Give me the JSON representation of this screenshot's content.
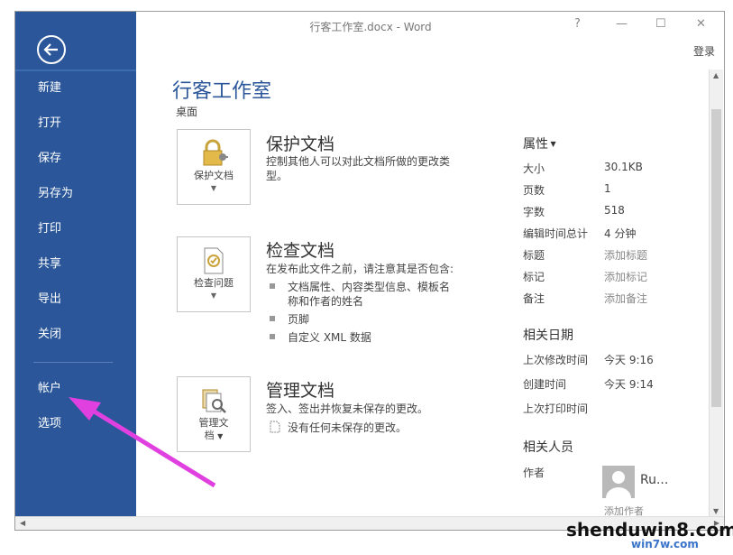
{
  "window": {
    "title": "行客工作室.docx - Word",
    "help": "?",
    "minimize": "—",
    "maximize": "☐",
    "close": "✕",
    "login": "登录"
  },
  "sidebar": {
    "items": [
      {
        "label": "新建"
      },
      {
        "label": "打开"
      },
      {
        "label": "保存"
      },
      {
        "label": "另存为"
      },
      {
        "label": "打印"
      },
      {
        "label": "共享"
      },
      {
        "label": "导出"
      },
      {
        "label": "关闭"
      },
      {
        "label": "帐户"
      },
      {
        "label": "选项"
      }
    ]
  },
  "main": {
    "title": "行客工作室",
    "path": "桌面",
    "protect": {
      "button": "保护文档",
      "title": "保护文档",
      "desc": "控制其他人可以对此文档所做的更改类型。"
    },
    "inspect": {
      "button": "检查问题",
      "title": "检查文档",
      "desc": "在发布此文件之前，请注意其是否包含:",
      "bullets": [
        "文档属性、内容类型信息、模板名称和作者的姓名",
        "页脚",
        "自定义 XML 数据"
      ]
    },
    "manage": {
      "button_line1": "管理文",
      "button_line2": "档",
      "title": "管理文档",
      "desc": "签入、签出并恢复未保存的更改。",
      "note": "没有任何未保存的更改。"
    }
  },
  "properties": {
    "heading": "属性",
    "rows": [
      {
        "label": "大小",
        "value": "30.1KB"
      },
      {
        "label": "页数",
        "value": "1"
      },
      {
        "label": "字数",
        "value": "518"
      },
      {
        "label": "编辑时间总计",
        "value": "4 分钟"
      },
      {
        "label": "标题",
        "value": "添加标题"
      },
      {
        "label": "标记",
        "value": "添加标记"
      },
      {
        "label": "备注",
        "value": "添加备注"
      }
    ],
    "dates_heading": "相关日期",
    "dates": [
      {
        "label": "上次修改时间",
        "value": "今天 9:16"
      },
      {
        "label": "创建时间",
        "value": "今天 9:14"
      },
      {
        "label": "上次打印时间",
        "value": ""
      }
    ],
    "people_heading": "相关人员",
    "author_label": "作者",
    "author_name": "Ru...",
    "add_author": "添加作者"
  },
  "watermark": {
    "text": "shenduwin8.com",
    "sub": "win7w.com"
  },
  "colors": {
    "sidebar": "#2b579a",
    "accent": "#2b579a",
    "arrow": "#e040e0"
  }
}
